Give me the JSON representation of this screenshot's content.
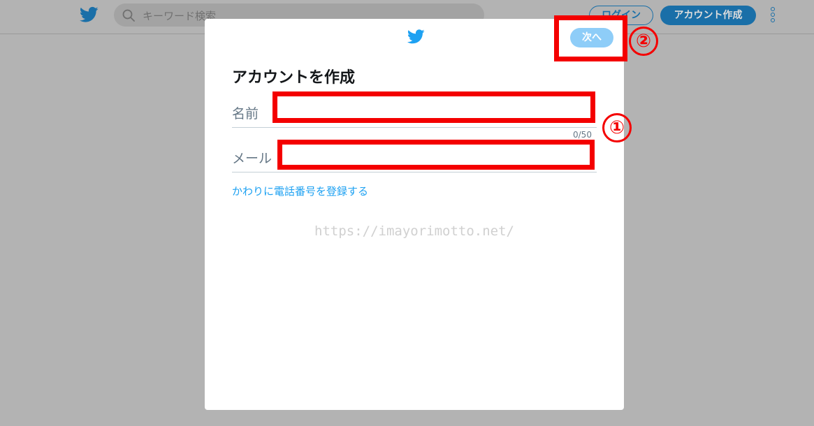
{
  "header": {
    "logo_icon": "twitter-bird-icon",
    "search_placeholder": "キーワード検索",
    "login_label": "ログイン",
    "signup_label": "アカウント作成",
    "more_icon": "more-vertical-icon"
  },
  "modal": {
    "logo_icon": "twitter-bird-icon",
    "next_label": "次へ",
    "title": "アカウントを作成",
    "name_label": "名前",
    "name_counter": "0/50",
    "email_label": "メール",
    "phone_link": "かわりに電話番号を登録する",
    "watermark": "https://imayorimotto.net/"
  },
  "annotations": {
    "marker_fields": "①",
    "marker_next": "②",
    "color": "#f40000"
  },
  "colors": {
    "brand": "#1da1f2",
    "overlay": "#b3b3b3"
  }
}
